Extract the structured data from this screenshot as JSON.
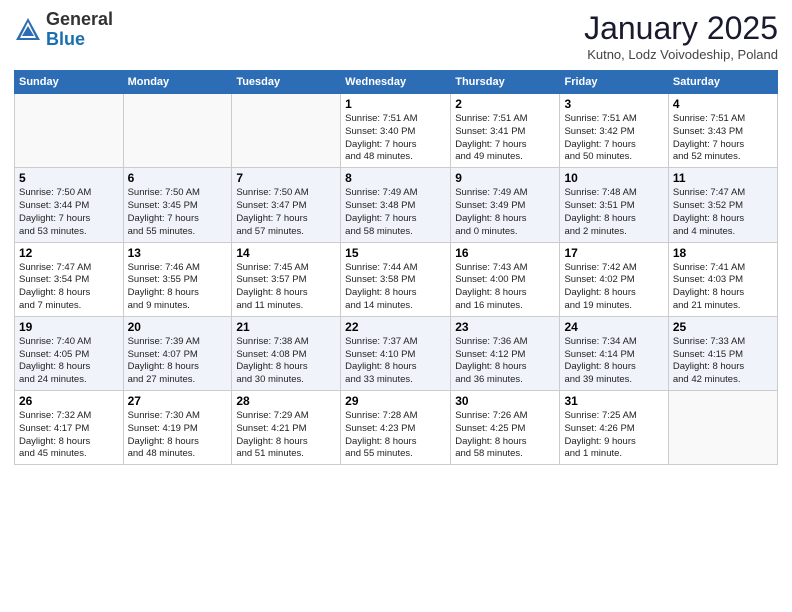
{
  "header": {
    "logo_general": "General",
    "logo_blue": "Blue",
    "month_title": "January 2025",
    "subtitle": "Kutno, Lodz Voivodeship, Poland"
  },
  "days_of_week": [
    "Sunday",
    "Monday",
    "Tuesday",
    "Wednesday",
    "Thursday",
    "Friday",
    "Saturday"
  ],
  "weeks": [
    [
      {
        "day": "",
        "info": ""
      },
      {
        "day": "",
        "info": ""
      },
      {
        "day": "",
        "info": ""
      },
      {
        "day": "1",
        "info": "Sunrise: 7:51 AM\nSunset: 3:40 PM\nDaylight: 7 hours\nand 48 minutes."
      },
      {
        "day": "2",
        "info": "Sunrise: 7:51 AM\nSunset: 3:41 PM\nDaylight: 7 hours\nand 49 minutes."
      },
      {
        "day": "3",
        "info": "Sunrise: 7:51 AM\nSunset: 3:42 PM\nDaylight: 7 hours\nand 50 minutes."
      },
      {
        "day": "4",
        "info": "Sunrise: 7:51 AM\nSunset: 3:43 PM\nDaylight: 7 hours\nand 52 minutes."
      }
    ],
    [
      {
        "day": "5",
        "info": "Sunrise: 7:50 AM\nSunset: 3:44 PM\nDaylight: 7 hours\nand 53 minutes."
      },
      {
        "day": "6",
        "info": "Sunrise: 7:50 AM\nSunset: 3:45 PM\nDaylight: 7 hours\nand 55 minutes."
      },
      {
        "day": "7",
        "info": "Sunrise: 7:50 AM\nSunset: 3:47 PM\nDaylight: 7 hours\nand 57 minutes."
      },
      {
        "day": "8",
        "info": "Sunrise: 7:49 AM\nSunset: 3:48 PM\nDaylight: 7 hours\nand 58 minutes."
      },
      {
        "day": "9",
        "info": "Sunrise: 7:49 AM\nSunset: 3:49 PM\nDaylight: 8 hours\nand 0 minutes."
      },
      {
        "day": "10",
        "info": "Sunrise: 7:48 AM\nSunset: 3:51 PM\nDaylight: 8 hours\nand 2 minutes."
      },
      {
        "day": "11",
        "info": "Sunrise: 7:47 AM\nSunset: 3:52 PM\nDaylight: 8 hours\nand 4 minutes."
      }
    ],
    [
      {
        "day": "12",
        "info": "Sunrise: 7:47 AM\nSunset: 3:54 PM\nDaylight: 8 hours\nand 7 minutes."
      },
      {
        "day": "13",
        "info": "Sunrise: 7:46 AM\nSunset: 3:55 PM\nDaylight: 8 hours\nand 9 minutes."
      },
      {
        "day": "14",
        "info": "Sunrise: 7:45 AM\nSunset: 3:57 PM\nDaylight: 8 hours\nand 11 minutes."
      },
      {
        "day": "15",
        "info": "Sunrise: 7:44 AM\nSunset: 3:58 PM\nDaylight: 8 hours\nand 14 minutes."
      },
      {
        "day": "16",
        "info": "Sunrise: 7:43 AM\nSunset: 4:00 PM\nDaylight: 8 hours\nand 16 minutes."
      },
      {
        "day": "17",
        "info": "Sunrise: 7:42 AM\nSunset: 4:02 PM\nDaylight: 8 hours\nand 19 minutes."
      },
      {
        "day": "18",
        "info": "Sunrise: 7:41 AM\nSunset: 4:03 PM\nDaylight: 8 hours\nand 21 minutes."
      }
    ],
    [
      {
        "day": "19",
        "info": "Sunrise: 7:40 AM\nSunset: 4:05 PM\nDaylight: 8 hours\nand 24 minutes."
      },
      {
        "day": "20",
        "info": "Sunrise: 7:39 AM\nSunset: 4:07 PM\nDaylight: 8 hours\nand 27 minutes."
      },
      {
        "day": "21",
        "info": "Sunrise: 7:38 AM\nSunset: 4:08 PM\nDaylight: 8 hours\nand 30 minutes."
      },
      {
        "day": "22",
        "info": "Sunrise: 7:37 AM\nSunset: 4:10 PM\nDaylight: 8 hours\nand 33 minutes."
      },
      {
        "day": "23",
        "info": "Sunrise: 7:36 AM\nSunset: 4:12 PM\nDaylight: 8 hours\nand 36 minutes."
      },
      {
        "day": "24",
        "info": "Sunrise: 7:34 AM\nSunset: 4:14 PM\nDaylight: 8 hours\nand 39 minutes."
      },
      {
        "day": "25",
        "info": "Sunrise: 7:33 AM\nSunset: 4:15 PM\nDaylight: 8 hours\nand 42 minutes."
      }
    ],
    [
      {
        "day": "26",
        "info": "Sunrise: 7:32 AM\nSunset: 4:17 PM\nDaylight: 8 hours\nand 45 minutes."
      },
      {
        "day": "27",
        "info": "Sunrise: 7:30 AM\nSunset: 4:19 PM\nDaylight: 8 hours\nand 48 minutes."
      },
      {
        "day": "28",
        "info": "Sunrise: 7:29 AM\nSunset: 4:21 PM\nDaylight: 8 hours\nand 51 minutes."
      },
      {
        "day": "29",
        "info": "Sunrise: 7:28 AM\nSunset: 4:23 PM\nDaylight: 8 hours\nand 55 minutes."
      },
      {
        "day": "30",
        "info": "Sunrise: 7:26 AM\nSunset: 4:25 PM\nDaylight: 8 hours\nand 58 minutes."
      },
      {
        "day": "31",
        "info": "Sunrise: 7:25 AM\nSunset: 4:26 PM\nDaylight: 9 hours\nand 1 minute."
      },
      {
        "day": "",
        "info": ""
      }
    ]
  ]
}
